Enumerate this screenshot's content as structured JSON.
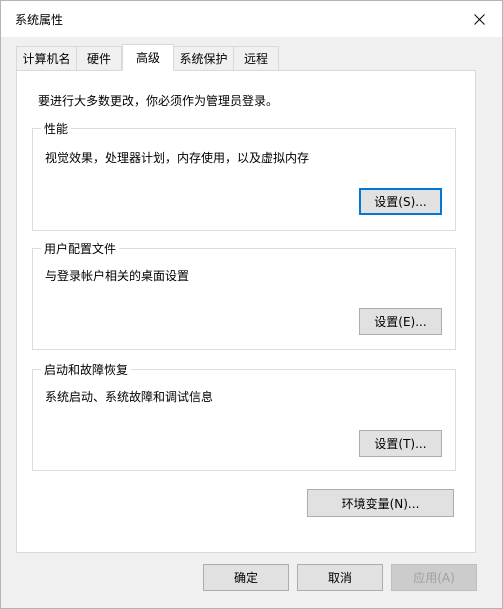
{
  "window": {
    "title": "系统属性"
  },
  "tabs": [
    {
      "label": "计算机名"
    },
    {
      "label": "硬件"
    },
    {
      "label": "高级"
    },
    {
      "label": "系统保护"
    },
    {
      "label": "远程"
    }
  ],
  "active_tab": "高级",
  "panel": {
    "admin_note": "要进行大多数更改，你必须作为管理员登录。",
    "performance": {
      "title": "性能",
      "description": "视觉效果，处理器计划，内存使用，以及虚拟内存",
      "button": "设置(S)..."
    },
    "user_profiles": {
      "title": "用户配置文件",
      "description": "与登录帐户相关的桌面设置",
      "button": "设置(E)..."
    },
    "startup_recovery": {
      "title": "启动和故障恢复",
      "description": "系统启动、系统故障和调试信息",
      "button": "设置(T)..."
    },
    "env_vars_button": "环境变量(N)..."
  },
  "footer": {
    "ok": "确定",
    "cancel": "取消",
    "apply": "应用(A)"
  },
  "colors": {
    "focus_border": "#0078d7",
    "button_bg": "#e1e1e1",
    "panel_bg": "#ffffff",
    "window_bg": "#f0f0f0"
  }
}
